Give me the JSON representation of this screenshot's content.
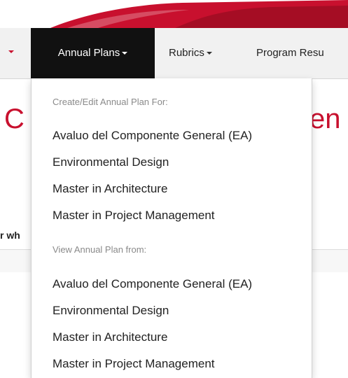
{
  "navbar": {
    "items": [
      {
        "label": "Annual Plans"
      },
      {
        "label": "Rubrics"
      },
      {
        "label": "Program Resu"
      }
    ]
  },
  "page": {
    "heading_left": "C",
    "heading_right": "en",
    "snippet": "r wh"
  },
  "dropdown": {
    "create_header": "Create/Edit Annual Plan For:",
    "create_items": [
      "Avaluo del Componente General (EA)",
      "Environmental Design",
      "Master in Architecture",
      "Master in Project Management"
    ],
    "view_header": "View Annual Plan from:",
    "view_items": [
      "Avaluo del Componente General (EA)",
      "Environmental Design",
      "Master in Architecture",
      "Master in Project Management"
    ]
  },
  "colors": {
    "accent": "#c8102e",
    "nav_active_bg": "#111111",
    "navbar_bg": "#f1f1f1"
  }
}
